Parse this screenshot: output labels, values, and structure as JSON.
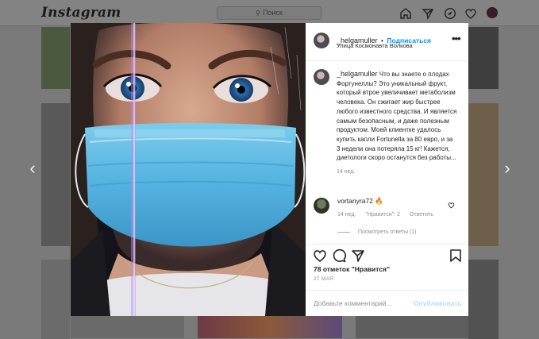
{
  "topbar": {
    "logo": "Instagram",
    "search_placeholder": "Поиск"
  },
  "post": {
    "username": "_helgamuller",
    "separator": "•",
    "follow_label": "Подписаться",
    "location": "Улица Космонавта Волкова",
    "more_label": "•••",
    "caption_username": "_helgamuller",
    "caption_text": "Что вы знаете о плодах Фортунеллы? Это уникальный фрукт, который втрое увеличивает метаболизм человека. Он сжигает жир быстрее любого известного средства. И является самым безопасным, и даже полезным продуктом. Моей клиентке удалось купить капли Fortunella за 80 евро, и за 3 недели она потеряла 15 кг! Кажется, диетологи скоро останутся без работы...",
    "caption_time": "14 нед.",
    "likes": "78 отметок \"Нравится\"",
    "date": "27 МАЯ",
    "comment_placeholder": "Добавьте комментарий...",
    "publish_label": "Опубликовать"
  },
  "comment": {
    "username": "vortanyra72",
    "emoji": "🔥",
    "time": "14 нед.",
    "likes": "\"Нравится\": 2",
    "reply_label": "Ответить",
    "view_replies": "Посмотреть ответы (1)"
  },
  "colors": {
    "accent": "#0095f6",
    "mask": "#58b6e3",
    "panel_bg": "#ffffff"
  },
  "icons": {
    "nav": [
      "home-icon",
      "direct-icon",
      "explore-icon",
      "heart-icon",
      "profile-avatar"
    ],
    "actions": [
      "like-icon",
      "comment-icon",
      "share-icon",
      "save-icon"
    ]
  }
}
